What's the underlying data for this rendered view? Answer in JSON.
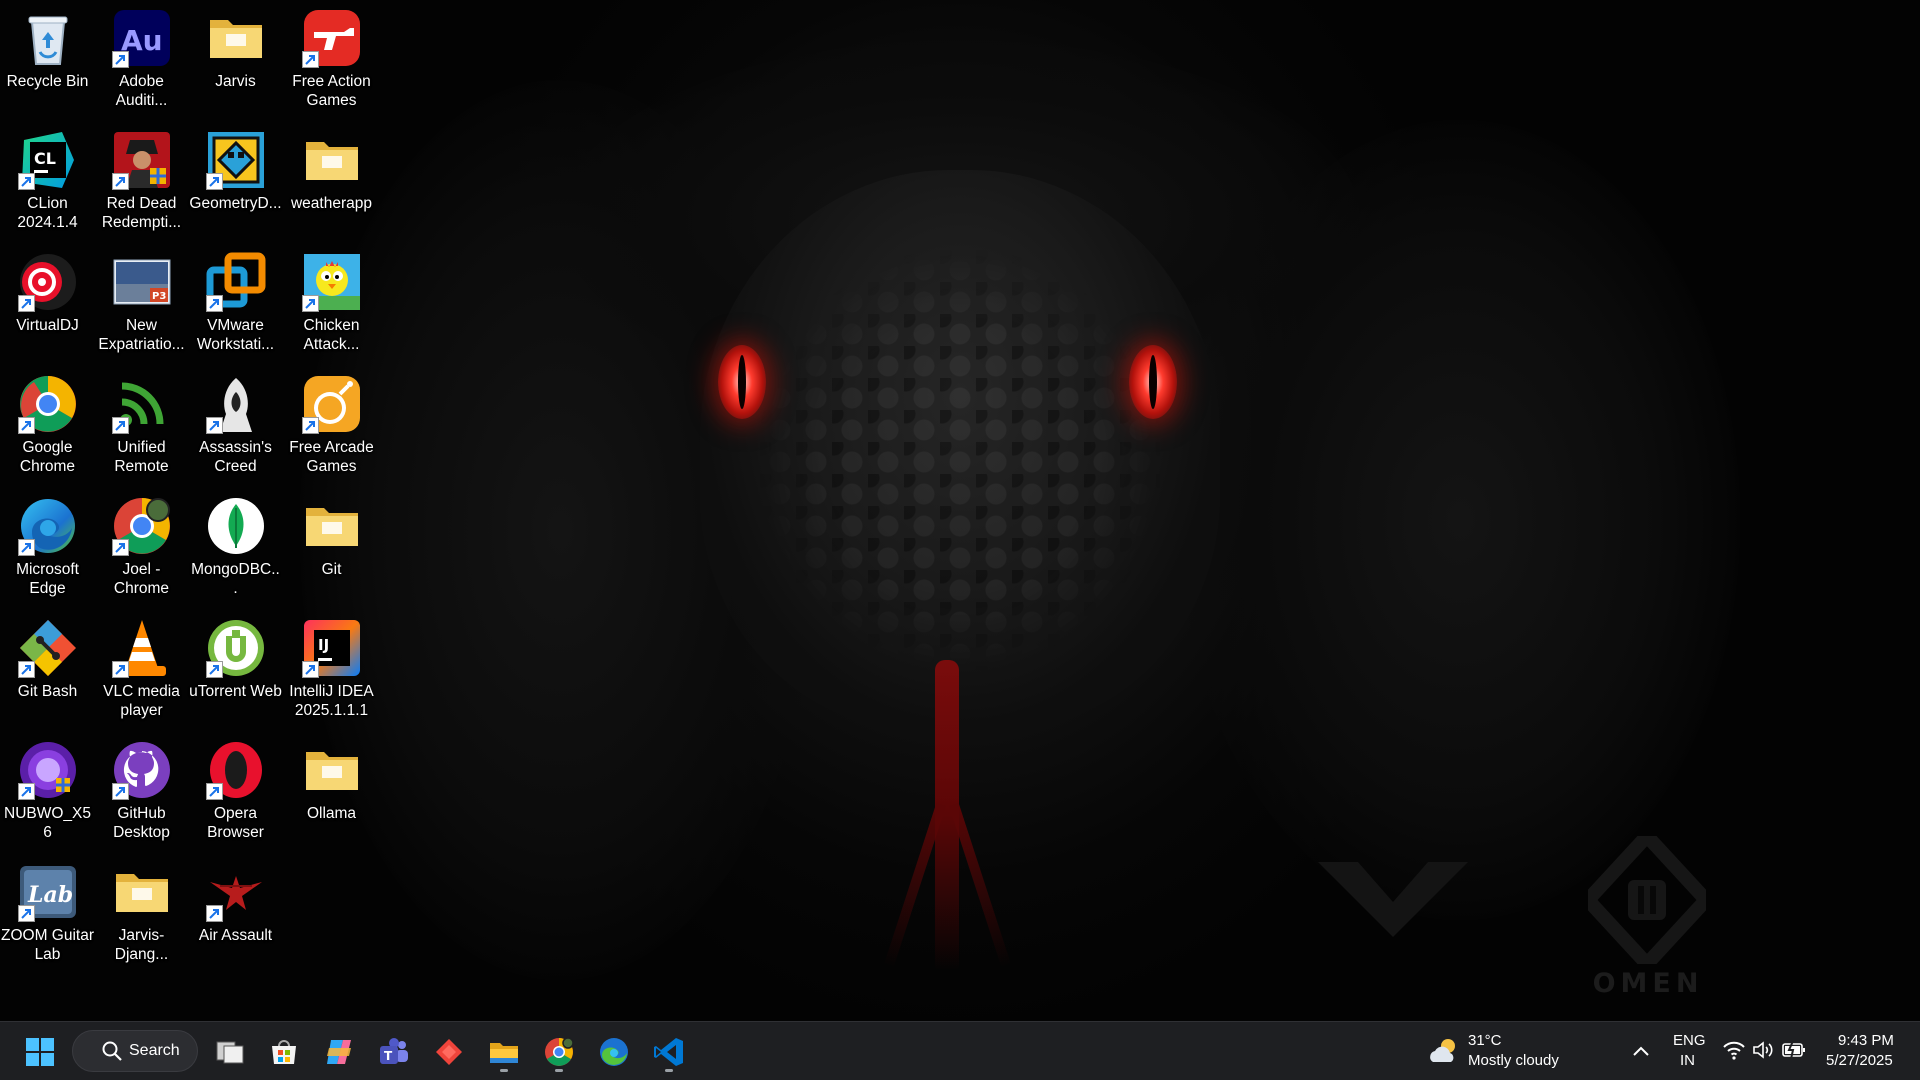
{
  "desktop": {
    "wallpaper": "black snake with red eyes, OMEN branding",
    "brand_text": "OMEN",
    "icons": [
      {
        "label": "Recycle Bin",
        "icon": "recycle-bin-icon",
        "shortcut": false
      },
      {
        "label": "CLion 2024.1.4",
        "icon": "clion-icon",
        "shortcut": true
      },
      {
        "label": "VirtualDJ",
        "icon": "virtualdj-icon",
        "shortcut": true
      },
      {
        "label": "Google Chrome",
        "icon": "chrome-icon",
        "shortcut": true
      },
      {
        "label": "Microsoft Edge",
        "icon": "edge-icon",
        "shortcut": true
      },
      {
        "label": "Git Bash",
        "icon": "git-bash-icon",
        "shortcut": true
      },
      {
        "label": "NUBWO_X56",
        "icon": "nubwo-icon",
        "shortcut": true
      },
      {
        "label": "ZOOM Guitar Lab",
        "icon": "zoom-guitar-lab-icon",
        "shortcut": true
      },
      {
        "label": "Adobe Auditi...",
        "icon": "adobe-audition-icon",
        "shortcut": true
      },
      {
        "label": "Red Dead Redempti...",
        "icon": "red-dead-redemption-icon",
        "shortcut": true
      },
      {
        "label": "New Expatriatio...",
        "icon": "powerpoint-file-icon",
        "shortcut": false
      },
      {
        "label": "Unified Remote",
        "icon": "unified-remote-icon",
        "shortcut": true
      },
      {
        "label": "Joel - Chrome",
        "icon": "chrome-profile-icon",
        "shortcut": true
      },
      {
        "label": "VLC media player",
        "icon": "vlc-icon",
        "shortcut": true
      },
      {
        "label": "GitHub Desktop",
        "icon": "github-desktop-icon",
        "shortcut": true
      },
      {
        "label": "Jarvis-Djang...",
        "icon": "folder-icon",
        "shortcut": false
      },
      {
        "label": "Jarvis",
        "icon": "folder-icon",
        "shortcut": false
      },
      {
        "label": "GeometryD...",
        "icon": "geometry-dash-icon",
        "shortcut": true
      },
      {
        "label": "VMware Workstati...",
        "icon": "vmware-icon",
        "shortcut": true
      },
      {
        "label": "Assassin's Creed",
        "icon": "assassins-creed-icon",
        "shortcut": true
      },
      {
        "label": "MongoDBC...",
        "icon": "mongodb-compass-icon",
        "shortcut": false
      },
      {
        "label": "uTorrent Web",
        "icon": "utorrent-icon",
        "shortcut": true
      },
      {
        "label": "Opera Browser",
        "icon": "opera-icon",
        "shortcut": true
      },
      {
        "label": "Air Assault",
        "icon": "air-assault-icon",
        "shortcut": true
      },
      {
        "label": "Free Action Games",
        "icon": "free-action-games-icon",
        "shortcut": true
      },
      {
        "label": "weatherapp",
        "icon": "folder-icon",
        "shortcut": false
      },
      {
        "label": "Chicken Attack...",
        "icon": "chicken-attack-icon",
        "shortcut": true
      },
      {
        "label": "Free Arcade Games",
        "icon": "free-arcade-games-icon",
        "shortcut": true
      },
      {
        "label": "Git",
        "icon": "folder-icon",
        "shortcut": false
      },
      {
        "label": "IntelliJ IDEA 2025.1.1.1",
        "icon": "intellij-idea-icon",
        "shortcut": true
      },
      {
        "label": "Ollama",
        "icon": "folder-icon",
        "shortcut": false
      }
    ]
  },
  "taskbar": {
    "search_label": "Search",
    "apps": [
      {
        "name": "start",
        "icon": "windows-start-icon",
        "running": false
      },
      {
        "name": "task-view",
        "icon": "task-view-icon",
        "running": false
      },
      {
        "name": "microsoft-store",
        "icon": "microsoft-store-icon",
        "running": false
      },
      {
        "name": "copilot",
        "icon": "copilot-icon",
        "running": false
      },
      {
        "name": "teams",
        "icon": "teams-icon",
        "running": false
      },
      {
        "name": "anydesk",
        "icon": "anydesk-icon",
        "running": false
      },
      {
        "name": "file-explorer",
        "icon": "file-explorer-icon",
        "running": true
      },
      {
        "name": "chrome",
        "icon": "chrome-icon",
        "running": true
      },
      {
        "name": "edge",
        "icon": "edge-icon",
        "running": false
      },
      {
        "name": "vscode",
        "icon": "vscode-icon",
        "running": true
      }
    ],
    "weather": {
      "temp": "31°C",
      "condition": "Mostly cloudy",
      "icon": "partly-cloudy-icon"
    },
    "language": {
      "lang": "ENG",
      "region": "IN"
    },
    "clock": {
      "time": "9:43 PM",
      "date": "5/27/2025"
    },
    "tray_icons": [
      "show-hidden-icons-chevron",
      "wifi-icon",
      "volume-icon",
      "battery-charging-icon"
    ]
  },
  "colors": {
    "taskbar_bg": "#1e1f22",
    "eye_red": "#ff3b2e"
  }
}
